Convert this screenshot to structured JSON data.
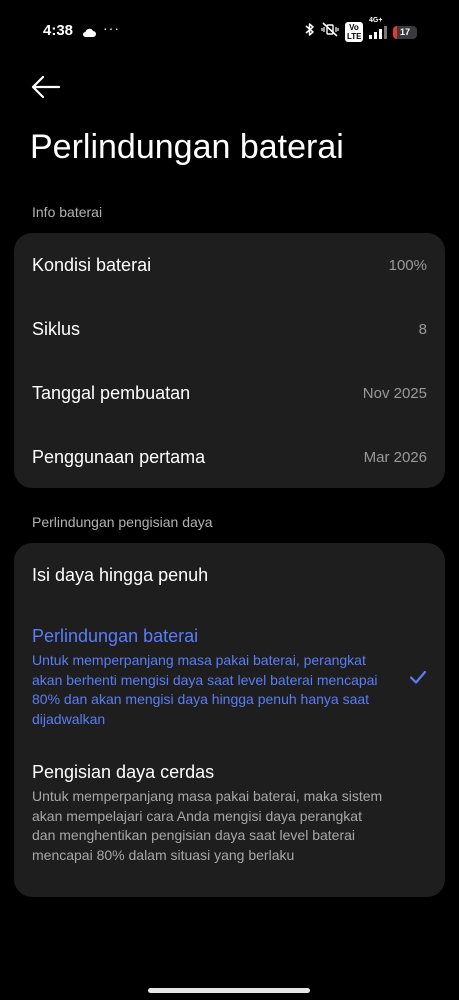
{
  "status_bar": {
    "time": "4:38",
    "dots": "···",
    "volte": "Vo LTE",
    "network": "4G+",
    "battery": "17",
    "battery_level": 0.17,
    "icons": [
      "cloud-icon",
      "bluetooth-icon",
      "mute-vibrate-icon",
      "volte-icon",
      "signal-icon",
      "battery-icon"
    ]
  },
  "header": {
    "title": "Perlindungan baterai"
  },
  "info_section": {
    "header": "Info baterai",
    "rows": [
      {
        "label": "Kondisi baterai",
        "value": "100%"
      },
      {
        "label": "Siklus",
        "value": "8"
      },
      {
        "label": "Tanggal pembuatan",
        "value": "Nov 2025"
      },
      {
        "label": "Penggunaan pertama",
        "value": "Mar 2026"
      }
    ]
  },
  "charging_section": {
    "header": "Perlindungan pengisian daya",
    "options": [
      {
        "title": "Isi daya hingga penuh",
        "description": "",
        "selected": false
      },
      {
        "title": "Perlindungan baterai",
        "description": "Untuk memperpanjang masa pakai baterai, perangkat akan berhenti mengisi daya saat level baterai mencapai 80% dan akan mengisi daya hingga penuh hanya saat dijadwalkan",
        "selected": true
      },
      {
        "title": "Pengisian daya cerdas",
        "description": "Untuk memperpanjang masa pakai baterai, maka sistem akan mempelajari cara Anda mengisi daya perangkat dan menghentikan pengisian daya saat level baterai mencapai 80% dalam situasi yang berlaku",
        "selected": false
      }
    ]
  },
  "colors": {
    "background": "#000000",
    "card": "#1e1e1f",
    "accent": "#5b7cf7",
    "battery_low": "#e53935"
  }
}
